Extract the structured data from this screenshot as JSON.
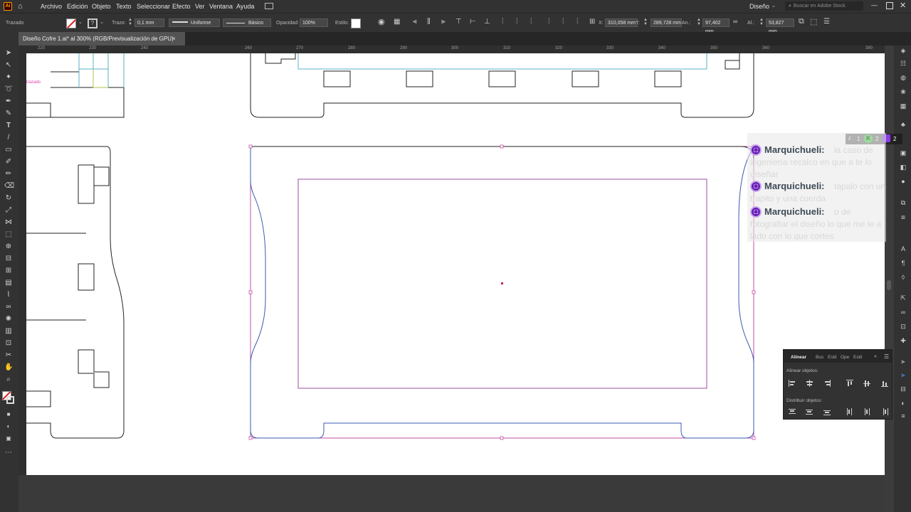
{
  "app": {
    "menus": [
      "Archivo",
      "Edición",
      "Objeto",
      "Texto",
      "Seleccionar",
      "Efecto",
      "Ver",
      "Ventana",
      "Ayuda"
    ],
    "workspace": "Diseño",
    "search_placeholder": "Buscar en Adobe Stock"
  },
  "control_bar": {
    "selection_label": "Trazado",
    "stroke_label": "Trazo:",
    "stroke_value": "0,1 mm",
    "profile_value": "Uniforme",
    "brush_value": "Básico",
    "opacity_label": "Opacidad:",
    "opacity_value": "100%",
    "style_label": "Estilo:",
    "x_label": "X:",
    "x_value": "310,058 mm",
    "y_label": "Y:",
    "y_value": "289,728 mm",
    "w_label": "An.:",
    "w_value": "97,402 mm",
    "h_label": "Al.:",
    "h_value": "53,827 mm"
  },
  "document": {
    "tab_title": "Diseño Cofre 1.ai* al 300% (RGB/Previsualización de GPU)",
    "close_glyph": "×"
  },
  "ruler": {
    "h_ticks": [
      "220",
      "230",
      "240",
      "260",
      "270",
      "280",
      "290",
      "300",
      "310",
      "320",
      "330",
      "340",
      "350",
      "360",
      "380"
    ]
  },
  "canvas": {
    "tiny_label": "trazado"
  },
  "align_panel": {
    "tabs": [
      "Alinear",
      "Bus",
      "Estil",
      "Ope",
      "Estil"
    ],
    "align_objects_label": "Alinear objetos:",
    "distribute_objects_label": "Distribuir objetos:"
  },
  "chat": {
    "badge_counts": [
      "1",
      "2",
      "2"
    ],
    "messages": [
      {
        "user": "Marquichueli:",
        "text": "la caso de ingeniería recalco en que a te lo diseñar"
      },
      {
        "user": "Marquichueli:",
        "text": "tapalo con un trapito y una cuerda"
      },
      {
        "user": "Marquichueli:",
        "text": "o de fotografiar el diseño lo que me le a lado con lo que cortes"
      }
    ]
  }
}
